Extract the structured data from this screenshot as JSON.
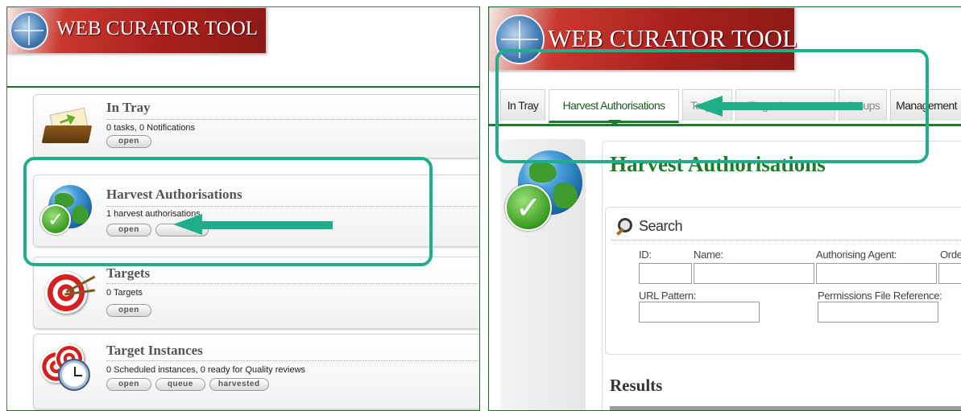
{
  "app": {
    "logo_text": "WEB CURATOR TOOL"
  },
  "left": {
    "cards": [
      {
        "title": "In Tray",
        "desc": "0 tasks, 0 Notifications",
        "buttons": [
          "open"
        ]
      },
      {
        "title": "Harvest Authorisations",
        "desc": "1 harvest authorisations",
        "buttons": [
          "open"
        ]
      },
      {
        "title": "Targets",
        "desc": "0 Targets",
        "buttons": [
          "open"
        ]
      },
      {
        "title": "Target Instances",
        "desc": "0 Scheduled instances, 0 ready for Quality reviews",
        "buttons": [
          "open",
          "queue",
          "harvested"
        ]
      }
    ]
  },
  "right": {
    "tabs": [
      "In Tray",
      "Harvest Authorisations",
      "Targets",
      "Target Instances",
      "Groups",
      "Management"
    ],
    "active_tab": "Harvest Authorisations",
    "page_title": "Harvest Authorisations",
    "search": {
      "title": "Search",
      "fields": {
        "id": "ID:",
        "name": "Name:",
        "authorising_agent": "Authorising Agent:",
        "order": "Orde",
        "url_pattern": "URL Pattern:",
        "permissions_file_reference": "Permissions File Reference:"
      }
    },
    "results_title": "Results"
  },
  "colors": {
    "accent_green": "#1f7a2e",
    "highlight_teal": "#1fae8a",
    "logo_red": "#a8201c"
  },
  "icons": [
    "in-tray-icon",
    "globe-check-icon",
    "target-icon",
    "clock-target-icon",
    "magnifier-icon"
  ]
}
